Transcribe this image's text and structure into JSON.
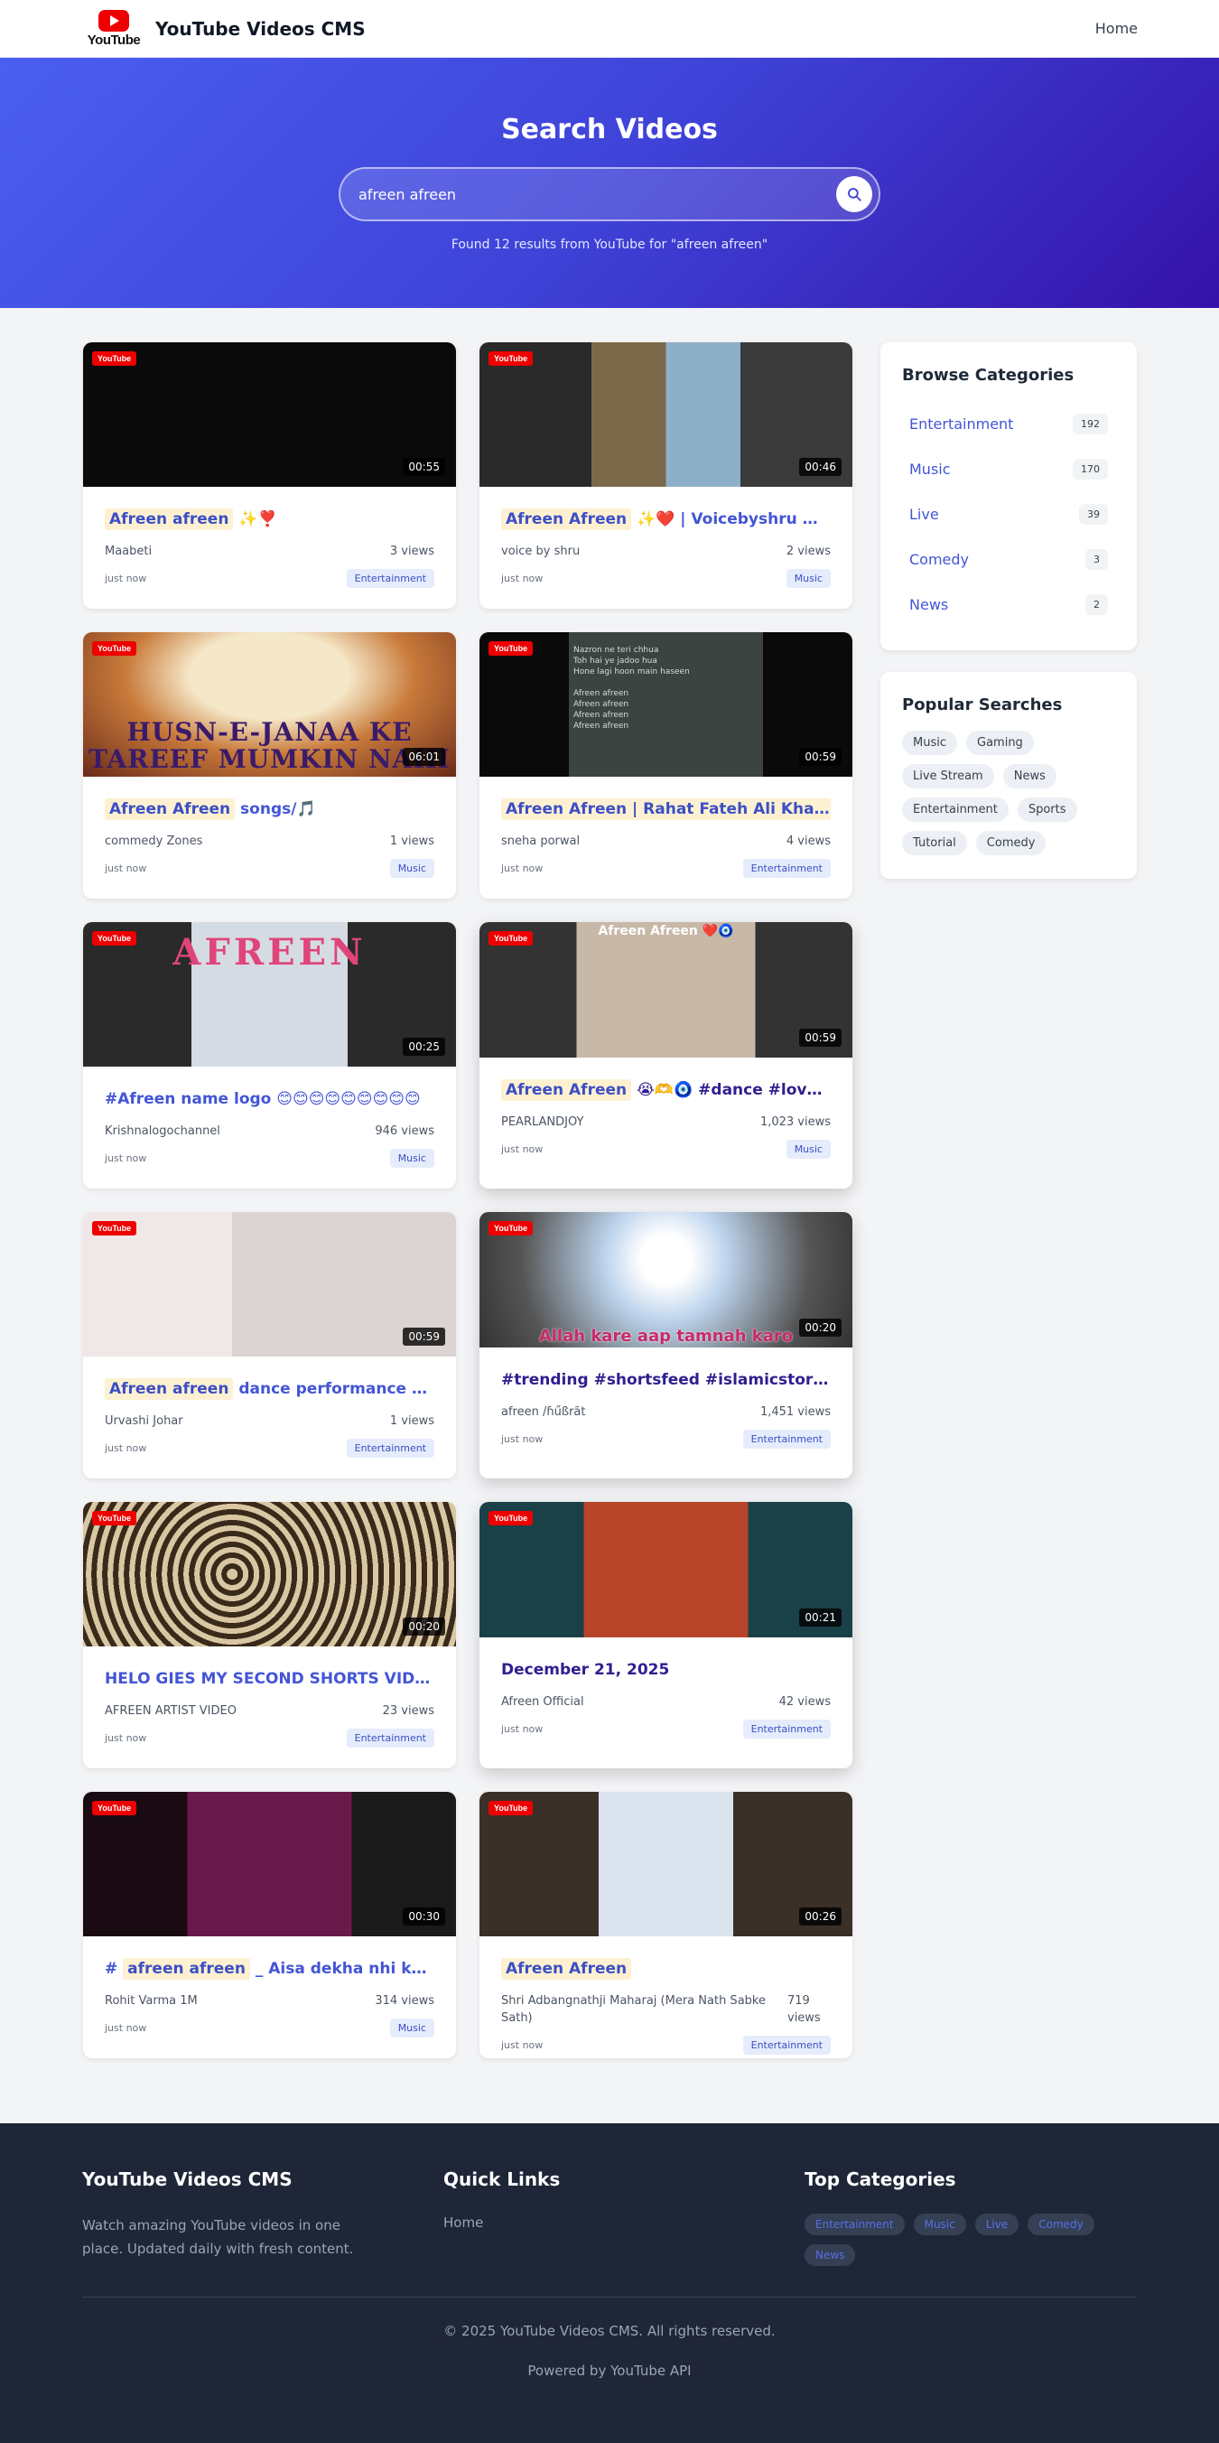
{
  "header": {
    "logo_word": "YouTube",
    "title": "YouTube Videos CMS",
    "nav_home": "Home"
  },
  "hero": {
    "heading": "Search Videos",
    "search_value": "afreen afreen",
    "result_text": "Found 12 results from YouTube for \"afreen afreen\""
  },
  "videos": [
    {
      "title_hl": "Afreen afreen",
      "title_rest": " ✨❣️",
      "channel": "Maabeti",
      "views": "3 views",
      "ago": "just now",
      "category": "Entertainment",
      "duration": "00:55",
      "badge": "YouTube"
    },
    {
      "title_hl": "Afreen Afreen",
      "title_rest": " ✨❤️ | Voicebyshru 👍 #shorts #ytshorts",
      "channel": "voice by shru",
      "views": "2 views",
      "ago": "just now",
      "category": "Music",
      "duration": "00:46",
      "badge": "YouTube"
    },
    {
      "title_hl": "Afreen Afreen",
      "title_rest": "  songs/🎵",
      "channel": "commedy Zones",
      "views": "1 views",
      "ago": "just now",
      "category": "Music",
      "duration": "06:01",
      "badge": "YouTube",
      "thumb_text": "HUSN-E-JANAA KE TAREEF MUMKIN NAHI"
    },
    {
      "title_hl": "Afreen Afreen | Rahat Fateh Ali Khan#lyrics",
      "title_rest": "",
      "channel": "sneha porwal",
      "views": "4 views",
      "ago": "just now",
      "category": "Entertainment",
      "duration": "00:59",
      "badge": "YouTube",
      "thumb_lines": [
        "Nazron ne teri chhua",
        "Toh hai ye jadoo hua",
        "Hone lagi hoon main haseen",
        "",
        "Afreen afreen",
        "Afreen afreen",
        "Afreen afreen",
        "Afreen afreen"
      ]
    },
    {
      "title_hl": "",
      "title_rest": "#Afreen name logo 😊😊😊😊😊😊😊😊😊",
      "channel": "Krishnalogochannel",
      "views": "946 views",
      "ago": "just now",
      "category": "Music",
      "duration": "00:25",
      "badge": "YouTube",
      "thumb_text": "AFREEN"
    },
    {
      "title_hl": "Afreen Afreen",
      "title_rest": "  😭🫶🧿 #dance #love #music",
      "channel": "PEARLANDJOY",
      "views": "1,023 views",
      "ago": "just now",
      "category": "Music",
      "duration": "00:59",
      "badge": "YouTube",
      "thumb_text": "Afreen Afreen ❤️🧿"
    },
    {
      "title_hl": "Afreen afreen",
      "title_rest": " dance performance solo song",
      "channel": "Urvashi Johar",
      "views": "1 views",
      "ago": "just now",
      "category": "Entertainment",
      "duration": "00:59",
      "badge": "YouTube"
    },
    {
      "title_hl": "",
      "title_rest": "#trending #shortsfeed #islamicstories",
      "channel": "afreen /ɦűßrãt",
      "views": "1,451 views",
      "ago": "just now",
      "category": "Entertainment",
      "duration": "00:20",
      "badge": "YouTube",
      "thumb_text": "Allah kare aap tamnah karo"
    },
    {
      "title_hl": "",
      "title_rest": "HELO GIES MY SECOND SHORTS VIDEO PLEASE",
      "channel": "AFREEN ARTIST VIDEO",
      "views": "23 views",
      "ago": "just now",
      "category": "Entertainment",
      "duration": "00:20",
      "badge": "YouTube"
    },
    {
      "title_hl": "",
      "title_rest": "December 21, 2025",
      "channel": "Afreen Official",
      "views": "42 views",
      "ago": "just now",
      "category": "Entertainment",
      "duration": "00:21",
      "badge": "YouTube"
    },
    {
      "title_pre": "# ",
      "title_hl": "afreen afreen",
      "title_rest": " _ Aisa dekha nhi khubsurat",
      "channel": "Rohit Varma 1M",
      "views": "314 views",
      "ago": "just now",
      "category": "Music",
      "duration": "00:30",
      "badge": "YouTube"
    },
    {
      "title_hl": "Afreen Afreen",
      "title_rest": "",
      "channel": "Shri Adbangnathji Maharaj (Mera Nath Sabke Sath)",
      "views": "719 views",
      "ago": "just now",
      "category": "Entertainment",
      "duration": "00:26",
      "badge": "YouTube"
    }
  ],
  "sidebar": {
    "categories_title": "Browse Categories",
    "categories": [
      {
        "name": "Entertainment",
        "count": "192"
      },
      {
        "name": "Music",
        "count": "170"
      },
      {
        "name": "Live",
        "count": "39"
      },
      {
        "name": "Comedy",
        "count": "3"
      },
      {
        "name": "News",
        "count": "2"
      }
    ],
    "popular_title": "Popular Searches",
    "popular": [
      "Music",
      "Gaming",
      "Live Stream",
      "News",
      "Entertainment",
      "Sports",
      "Tutorial",
      "Comedy"
    ]
  },
  "footer": {
    "about_title": "YouTube Videos CMS",
    "about_text": "Watch amazing YouTube videos in one place. Updated daily with fresh content.",
    "links_title": "Quick Links",
    "links": [
      "Home"
    ],
    "cats_title": "Top Categories",
    "cats": [
      "Entertainment",
      "Music",
      "Live",
      "Comedy",
      "News"
    ],
    "copyright": "© 2025 YouTube Videos CMS. All rights reserved.",
    "powered": "Powered by YouTube API"
  },
  "colors": {
    "accent": "#4355d6",
    "hero_start": "#4a5ef0",
    "hero_end": "#3512a9",
    "youtube_red": "#ee0000",
    "footer_bg": "#1f2637"
  },
  "icons": {
    "search": "search-icon",
    "logo": "youtube-logo"
  }
}
